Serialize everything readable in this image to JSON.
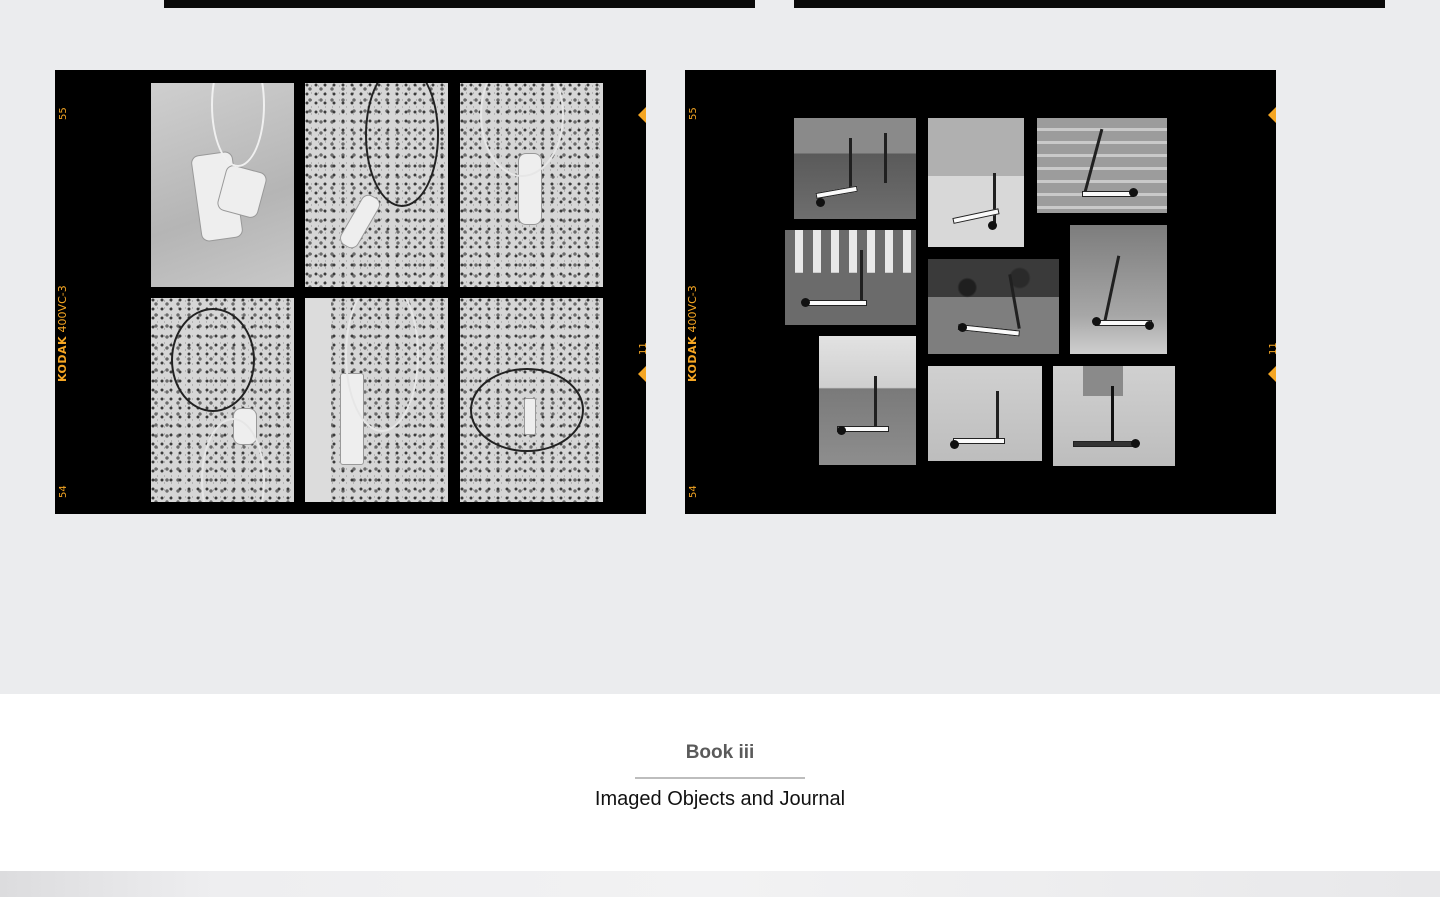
{
  "gallery": {
    "sheets": [
      {
        "film_brand": "KODAK",
        "film_type": "400VC-3",
        "frame_top": "55",
        "frame_bottom": "54",
        "frame_right": "11",
        "subject": "extension-cords"
      },
      {
        "film_brand": "KODAK",
        "film_type": "400VC-3",
        "frame_top": "55",
        "frame_bottom": "54",
        "frame_right": "11",
        "subject": "e-scooters"
      }
    ],
    "accent_color": "#f5a623"
  },
  "caption": {
    "kicker": "Book iii",
    "title": "Imaged Objects and Journal"
  }
}
